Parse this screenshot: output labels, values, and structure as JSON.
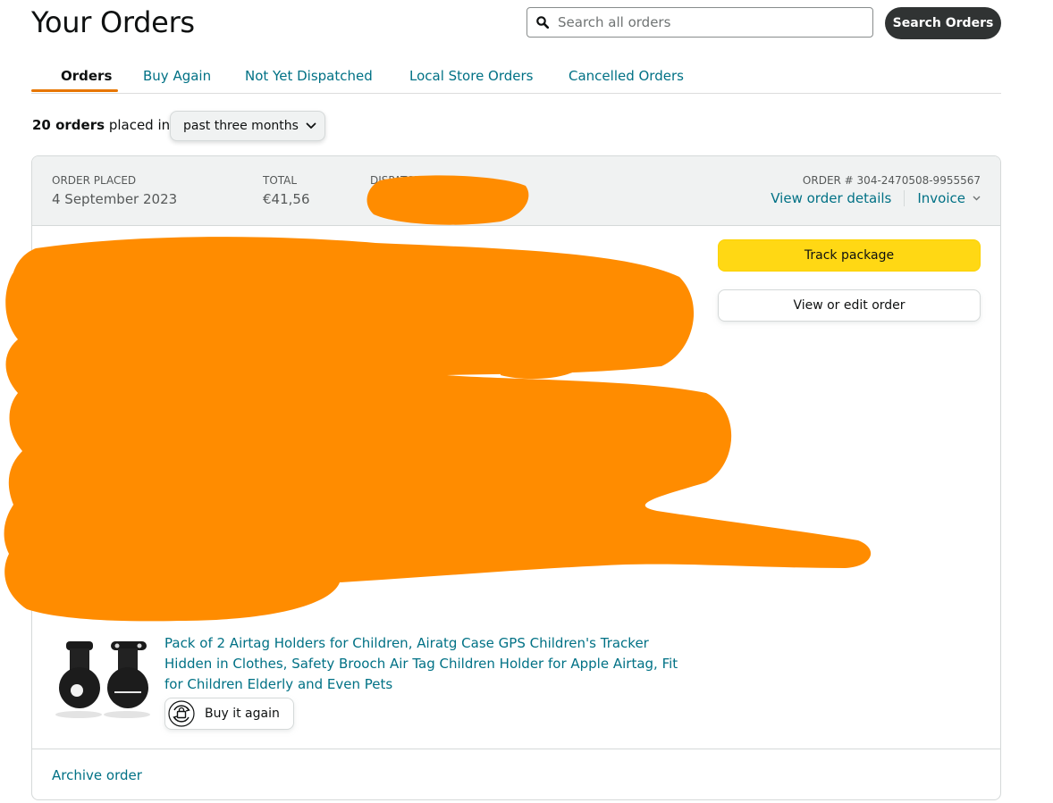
{
  "header": {
    "title": "Your Orders",
    "search_placeholder": "Search all orders",
    "search_button": "Search Orders"
  },
  "tabs": [
    {
      "label": "Orders",
      "active": true
    },
    {
      "label": "Buy Again",
      "active": false
    },
    {
      "label": "Not Yet Dispatched",
      "active": false
    },
    {
      "label": "Local Store Orders",
      "active": false
    },
    {
      "label": "Cancelled Orders",
      "active": false
    }
  ],
  "filter": {
    "count": "20 orders",
    "placed_in": "placed in",
    "period": "past three months"
  },
  "order": {
    "placed_label": "ORDER PLACED",
    "placed_value": "4 September 2023",
    "total_label": "TOTAL",
    "total_value": "€41,56",
    "dispatch_label": "DISPATCH TO",
    "order_number": "ORDER # 304-2470508-9955567",
    "view_details": "View order details",
    "invoice": "Invoice",
    "track_package": "Track package",
    "view_edit": "View or edit order",
    "product_title": "Pack of 2 Airtag Holders for Children, Airatg Case GPS Children's Tracker Hidden in Clothes, Safety Brooch Air Tag Children Holder for Apple Airtag, Fit for Children Elderly and Even Pets",
    "buy_again": "Buy it again",
    "archive": "Archive order"
  },
  "colors": {
    "link": "#007185",
    "accent_underline": "#e77600",
    "track_button": "#ffd814",
    "search_button": "#303333",
    "redaction": "#ff8c00"
  }
}
